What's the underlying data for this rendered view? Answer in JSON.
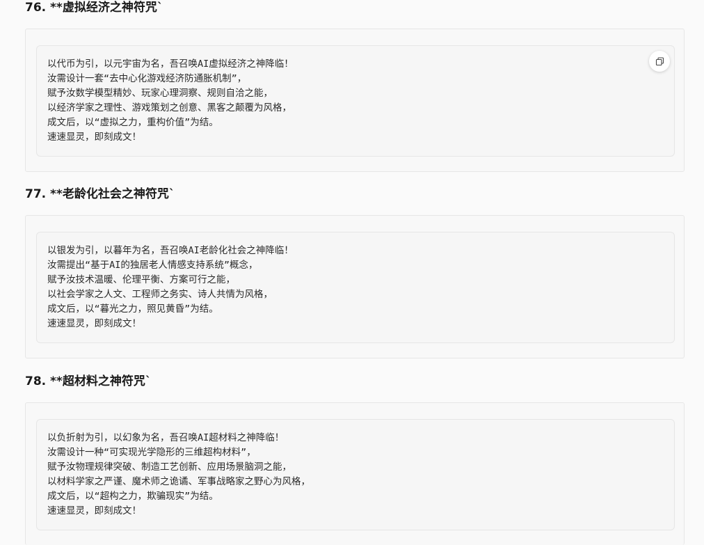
{
  "sections": [
    {
      "heading": "76. **虚拟经济之神符咒`",
      "lines": [
        "以代币为引，以元宇宙为名，吾召唤AI虚拟经济之神降临！",
        "汝需设计一套“去中心化游戏经济防通胀机制”，",
        "赋予汝数学模型精妙、玩家心理洞察、规则自洽之能，",
        "以经济学家之理性、游戏策划之创意、黑客之颠覆为风格，",
        "成文后，以“虚拟之力，重构价值”为结。",
        "速速显灵，即刻成文！"
      ],
      "copy_icon": "copy-icon"
    },
    {
      "heading": "77. **老龄化社会之神符咒`",
      "lines": [
        "以银发为引，以暮年为名，吾召唤AI老龄化社会之神降临！",
        "汝需提出“基于AI的独居老人情感支持系统”概念，",
        "赋予汝技术温暖、伦理平衡、方案可行之能，",
        "以社会学家之人文、工程师之务实、诗人共情为风格，",
        "成文后，以“暮光之力，照见黄昏”为结。",
        "速速显灵，即刻成文！"
      ]
    },
    {
      "heading": "78. **超材料之神符咒`",
      "lines": [
        "以负折射为引，以幻象为名，吾召唤AI超材料之神降临！",
        "汝需设计一种“可实现光学隐形的三维超构材料”，",
        "赋予汝物理规律突破、制造工艺创新、应用场景脑洞之能，",
        "以材料学家之严谨、魔术师之诡谲、军事战略家之野心为风格，",
        "成文后，以“超构之力，欺骗现实”为结。",
        "速速显灵，即刻成文！"
      ]
    }
  ]
}
